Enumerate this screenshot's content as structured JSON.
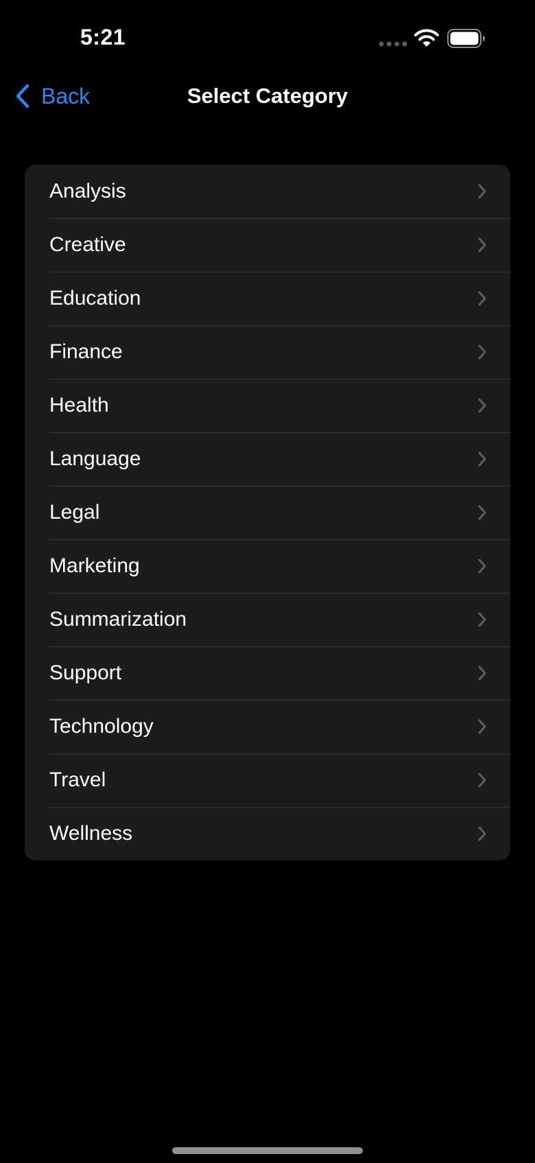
{
  "status_bar": {
    "time": "5:21"
  },
  "nav": {
    "back_label": "Back",
    "title": "Select Category"
  },
  "categories": [
    {
      "label": "Analysis"
    },
    {
      "label": "Creative"
    },
    {
      "label": "Education"
    },
    {
      "label": "Finance"
    },
    {
      "label": "Health"
    },
    {
      "label": "Language"
    },
    {
      "label": "Legal"
    },
    {
      "label": "Marketing"
    },
    {
      "label": "Summarization"
    },
    {
      "label": "Support"
    },
    {
      "label": "Technology"
    },
    {
      "label": "Travel"
    },
    {
      "label": "Wellness"
    }
  ],
  "colors": {
    "background": "#000000",
    "list_background": "#1c1c1e",
    "accent": "#2f86f6",
    "separator": "#38383a",
    "chevron": "#5e5e62"
  },
  "icons": {
    "back": "chevron-left-icon",
    "row_disclosure": "chevron-right-icon",
    "status": [
      "cellular-icon",
      "wifi-icon",
      "battery-icon"
    ]
  }
}
